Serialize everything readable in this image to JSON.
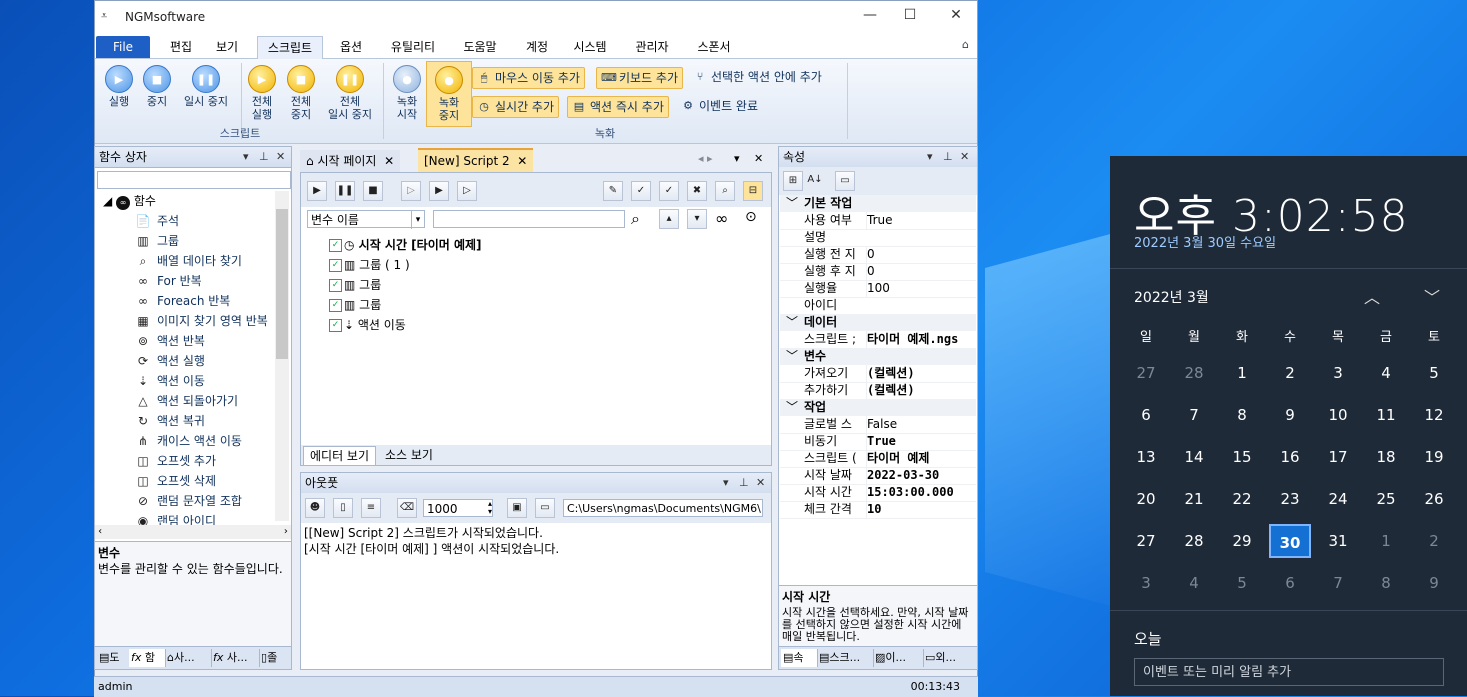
{
  "window": {
    "title": "NGMsoftware",
    "minimize": "—",
    "maximize": "☐",
    "close": "✕"
  },
  "menu_tabs": [
    {
      "label": "File"
    },
    {
      "label": "편집"
    },
    {
      "label": "보기"
    },
    {
      "label": "스크립트"
    },
    {
      "label": "옵션"
    },
    {
      "label": "유틸리티"
    },
    {
      "label": "도움말"
    },
    {
      "label": "계정"
    },
    {
      "label": "시스템"
    },
    {
      "label": "관리자"
    },
    {
      "label": "스폰서"
    }
  ],
  "ribbon": {
    "script_group": {
      "label": "스크립트",
      "buttons": [
        {
          "label": "실행"
        },
        {
          "label": "중지"
        },
        {
          "label": "일시 중지"
        },
        {
          "label": "전체\n실행"
        },
        {
          "label": "전체\n중지"
        },
        {
          "label": "전체\n일시 중지"
        }
      ]
    },
    "record_group": {
      "label": "녹화",
      "buttons": [
        {
          "label": "녹화\n시작"
        },
        {
          "label": "녹화\n중지"
        }
      ],
      "small": [
        {
          "label": "마우스 이동 추가"
        },
        {
          "label": "키보드 추가"
        },
        {
          "label": "선택한 액션 안에 추가"
        },
        {
          "label": "실시간 추가"
        },
        {
          "label": "액션 즉시 추가"
        },
        {
          "label": "이벤트 완료"
        }
      ]
    }
  },
  "toolbox": {
    "title": "함수 상자",
    "root": "함수",
    "items": [
      {
        "label": "주석"
      },
      {
        "label": "그룹"
      },
      {
        "label": "배열 데이타 찾기"
      },
      {
        "label": "For 반복"
      },
      {
        "label": "Foreach 반복"
      },
      {
        "label": "이미지 찾기 영역 반복"
      },
      {
        "label": "액션 반복"
      },
      {
        "label": "액션 실행"
      },
      {
        "label": "액션 이동"
      },
      {
        "label": "액션 되돌아가기"
      },
      {
        "label": "액션 복귀"
      },
      {
        "label": "캐이스 액션 이동"
      },
      {
        "label": "오프셋 추가"
      },
      {
        "label": "오프셋 삭제"
      },
      {
        "label": "랜덤 문자열 조합"
      },
      {
        "label": "랜덤 아이디"
      }
    ],
    "desc_title": "변수",
    "desc_text": "변수를 관리할 수 있는 함수들입니다.",
    "bottom_tabs": [
      {
        "label": "도"
      },
      {
        "label": "함"
      },
      {
        "label": "사..."
      },
      {
        "label": "사..."
      },
      {
        "label": "졸"
      }
    ]
  },
  "editor": {
    "tabs": [
      {
        "label": "시작 페이지"
      },
      {
        "label": "[New] Script 2"
      }
    ],
    "variable_select": "변수 이름",
    "rows": [
      {
        "label": "시작 시간 [타이머 예제]"
      },
      {
        "label": "그룹 ( 1 )"
      },
      {
        "label": "그룹"
      },
      {
        "label": "그룹"
      },
      {
        "label": "액션 이동"
      }
    ],
    "view_tabs": [
      {
        "label": "에디터 보기"
      },
      {
        "label": "소스 보기"
      }
    ]
  },
  "output": {
    "title": "아웃풋",
    "count": "1000",
    "path": "C:\\Users\\ngmas\\Documents\\NGM6\\",
    "lines": [
      "[[New] Script 2] 스크립트가 시작되었습니다.",
      "[시작 시간 [타이머 예제] ] 액션이 시작되었습니다."
    ]
  },
  "properties": {
    "title": "속성",
    "categories": [
      {
        "name": "기본 작업",
        "rows": [
          {
            "k": "사용 여부",
            "v": "True",
            "bold": false
          },
          {
            "k": "설명",
            "v": "",
            "bold": false
          },
          {
            "k": "실행 전 지",
            "v": "0",
            "bold": false
          },
          {
            "k": "실행 후 지",
            "v": "0",
            "bold": false
          },
          {
            "k": "실행율",
            "v": "100",
            "bold": false
          },
          {
            "k": "아이디",
            "v": "",
            "bold": false
          }
        ]
      },
      {
        "name": "데이터",
        "rows": [
          {
            "k": "스크립트 ;",
            "v": "타이머 예제.ngs",
            "bold": true
          }
        ]
      },
      {
        "name": "변수",
        "rows": [
          {
            "k": "가져오기",
            "v": "(컬렉션)",
            "bold": true
          },
          {
            "k": "추가하기",
            "v": "(컬렉션)",
            "bold": true
          }
        ]
      },
      {
        "name": "작업",
        "rows": [
          {
            "k": "글로벌 스",
            "v": "False",
            "bold": false
          },
          {
            "k": "비동기",
            "v": "True",
            "bold": true
          },
          {
            "k": "스크립트 (",
            "v": "타이머 예제",
            "bold": true
          },
          {
            "k": "시작 날짜",
            "v": "2022-03-30",
            "bold": true
          },
          {
            "k": "시작 시간",
            "v": "15:03:00.000",
            "bold": true
          },
          {
            "k": "체크 간격",
            "v": "10",
            "bold": true
          }
        ]
      }
    ],
    "desc_title": "시작 시간",
    "desc_text": "시작 시간을 선택하세요. 만약, 시작 날짜를 선택하지 않으면 설정한 시작 시간에 매일 반복됩니다.",
    "bottom_tabs": [
      {
        "label": "속"
      },
      {
        "label": "스크..."
      },
      {
        "label": "이..."
      },
      {
        "label": "외..."
      }
    ]
  },
  "status": {
    "user": "admin",
    "elapsed": "00:13:43"
  },
  "calendar": {
    "time": "오후 3:02:58",
    "date": "2022년 3월 30일 수요일",
    "month": "2022년 3월",
    "weekdays": [
      "일",
      "월",
      "화",
      "수",
      "목",
      "금",
      "토"
    ],
    "days": [
      [
        "27",
        "28",
        "1",
        "2",
        "3",
        "4",
        "5"
      ],
      [
        "6",
        "7",
        "8",
        "9",
        "10",
        "11",
        "12"
      ],
      [
        "13",
        "14",
        "15",
        "16",
        "17",
        "18",
        "19"
      ],
      [
        "20",
        "21",
        "22",
        "23",
        "24",
        "25",
        "26"
      ],
      [
        "27",
        "28",
        "29",
        "30",
        "31",
        "1",
        "2"
      ],
      [
        "3",
        "4",
        "5",
        "6",
        "7",
        "8",
        "9"
      ]
    ],
    "today": "30",
    "today_label": "오늘",
    "event_placeholder": "이벤트 또는 미리 알림 추가"
  }
}
